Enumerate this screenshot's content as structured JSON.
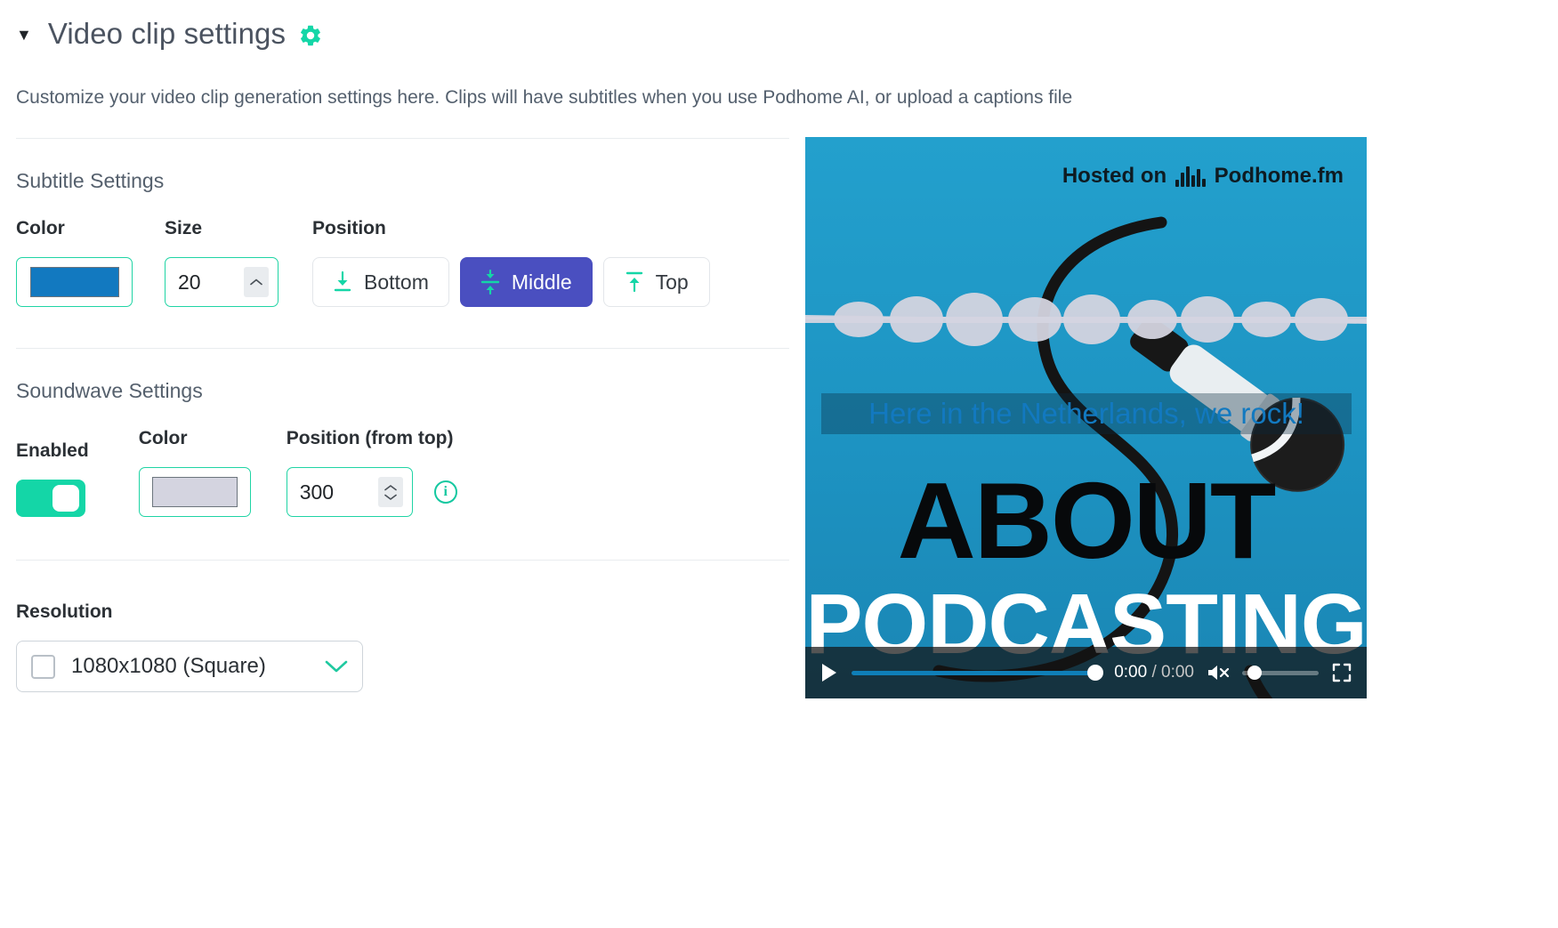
{
  "header": {
    "caret": "▼",
    "title": "Video clip settings",
    "gear_icon": "gear-icon",
    "accent_color": "#14d6a7",
    "description": "Customize your video clip generation settings here. Clips will have subtitles when you use Podhome AI, or upload a captions file"
  },
  "subtitle_settings": {
    "title": "Subtitle Settings",
    "color": {
      "label": "Color",
      "value": "#1279c0"
    },
    "size": {
      "label": "Size",
      "value": "20"
    },
    "position": {
      "label": "Position",
      "options": [
        {
          "label": "Bottom",
          "icon": "align-bottom-icon",
          "selected": false
        },
        {
          "label": "Middle",
          "icon": "align-middle-icon",
          "selected": true
        },
        {
          "label": "Top",
          "icon": "align-top-icon",
          "selected": false
        }
      ],
      "selected_value": "Middle",
      "selected_color": "#4a4fc0"
    }
  },
  "soundwave_settings": {
    "title": "Soundwave Settings",
    "enabled": {
      "label": "Enabled",
      "value": "on",
      "toggle_color": "#14d6a7"
    },
    "color": {
      "label": "Color",
      "value": "#d4d4e0"
    },
    "position_from_top": {
      "label": "Position (from top)",
      "value": "300",
      "info_icon": "info-icon"
    }
  },
  "resolution": {
    "label": "Resolution",
    "selected": "1080x1080 (Square)",
    "chevron_icon": "chevron-down-icon",
    "checkbox_icon": "square-icon"
  },
  "video_preview": {
    "hosted_label": "Hosted on",
    "hosted_brand": "Podhome.fm",
    "soundwave_icon": "soundwave-icon",
    "subtitle_text": "Here in the Netherlands, we rock!",
    "subtitle_color": "#1279c0",
    "cover_line1": "ABOUT",
    "cover_line2": "PODCASTING",
    "background_color": "#1b93c4",
    "player": {
      "play_icon": "play-icon",
      "current_time": "0:00",
      "time_separator": "/",
      "total_time": "0:00",
      "mute_icon": "volume-muted-icon",
      "fullscreen_icon": "fullscreen-icon"
    }
  }
}
